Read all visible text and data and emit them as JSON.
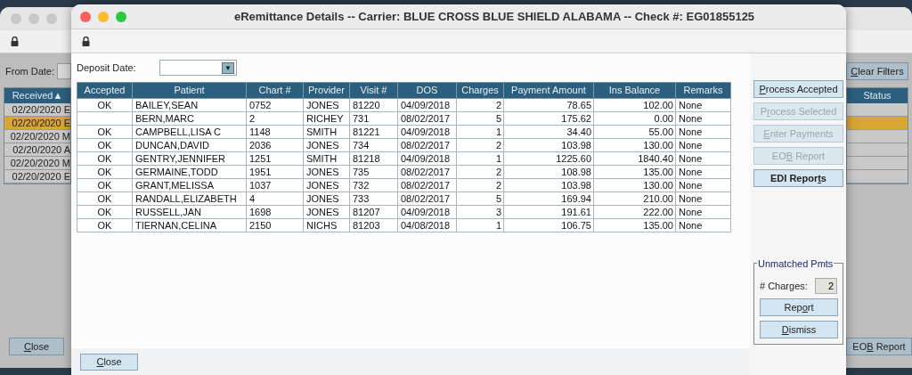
{
  "back_window": {
    "from_date_label": "From Date:",
    "clear_filters": {
      "key": "C",
      "post": "lear Filters"
    },
    "columns": [
      {
        "label": "Received▲"
      },
      {
        "label": "Status"
      }
    ],
    "rows": [
      {
        "received": "02/20/2020 E",
        "selected": false
      },
      {
        "received": "02/20/2020 E",
        "selected": true
      },
      {
        "received": "02/20/2020 M",
        "selected": false
      },
      {
        "received": "02/20/2020 A",
        "selected": false
      },
      {
        "received": "02/20/2020 M",
        "selected": false
      },
      {
        "received": "02/20/2020 E",
        "selected": false
      }
    ],
    "close": {
      "key": "C",
      "post": "lose"
    },
    "eob_report": {
      "pre": "EO",
      "key": "B",
      "post": " Report"
    }
  },
  "window": {
    "title": "eRemittance Details -- Carrier: BLUE CROSS BLUE SHIELD ALABAMA -- Check #: EG01855125"
  },
  "deposit_date": {
    "label": "Deposit Date:",
    "dropdown": "▼"
  },
  "table": {
    "columns": [
      {
        "label": "Accepted"
      },
      {
        "label": "Patient"
      },
      {
        "label": "Chart #"
      },
      {
        "label": "Provider"
      },
      {
        "label": "Visit #"
      },
      {
        "label": "DOS"
      },
      {
        "label": "Charges"
      },
      {
        "label": "Payment Amount"
      },
      {
        "label": "Ins Balance"
      },
      {
        "label": "Remarks"
      }
    ],
    "rows": [
      [
        "OK",
        "BAILEY,SEAN",
        "0752",
        "JONES",
        "81220",
        "04/09/2018",
        "2",
        "78.65",
        "102.00",
        "None"
      ],
      [
        "",
        "BERN,MARC",
        "2",
        "RICHEY",
        "731",
        "08/02/2017",
        "5",
        "175.62",
        "0.00",
        "None"
      ],
      [
        "OK",
        "CAMPBELL,LISA C",
        "1148",
        "SMITH",
        "81221",
        "04/09/2018",
        "1",
        "34.40",
        "55.00",
        "None"
      ],
      [
        "OK",
        "DUNCAN,DAVID",
        "2036",
        "JONES",
        "734",
        "08/02/2017",
        "2",
        "103.98",
        "130.00",
        "None"
      ],
      [
        "OK",
        "GENTRY,JENNIFER",
        "1251",
        "SMITH",
        "81218",
        "04/09/2018",
        "1",
        "1225.60",
        "1840.40",
        "None"
      ],
      [
        "OK",
        "GERMAINE,TODD",
        "1951",
        "JONES",
        "735",
        "08/02/2017",
        "2",
        "108.98",
        "135.00",
        "None"
      ],
      [
        "OK",
        "GRANT,MELISSA",
        "1037",
        "JONES",
        "732",
        "08/02/2017",
        "2",
        "103.98",
        "130.00",
        "None"
      ],
      [
        "OK",
        "RANDALL,ELIZABETH",
        "4",
        "JONES",
        "733",
        "08/02/2017",
        "5",
        "169.94",
        "210.00",
        "None"
      ],
      [
        "OK",
        "RUSSELL,JAN",
        "1698",
        "JONES",
        "81207",
        "04/09/2018",
        "3",
        "191.61",
        "222.00",
        "None"
      ],
      [
        "OK",
        "TIERNAN,CELINA",
        "2150",
        "NICHS",
        "81203",
        "04/08/2018",
        "1",
        "106.75",
        "135.00",
        "None"
      ]
    ]
  },
  "actions": [
    {
      "key": "P",
      "post": "rocess Accepted",
      "disabled": false,
      "bold": false
    },
    {
      "pre": "P",
      "key": "r",
      "post": "ocess Selected",
      "disabled": true,
      "bold": false
    },
    {
      "key": "E",
      "post": "nter Payments",
      "disabled": true,
      "bold": false
    },
    {
      "pre": "EO",
      "key": "B",
      "post": " Report",
      "disabled": true,
      "bold": false
    },
    {
      "pre": "EDI Repor",
      "key": "t",
      "post": "s",
      "disabled": false,
      "bold": true
    }
  ],
  "unmatched": {
    "title": "Unmatched Pmts",
    "charges_label": "# Charges:",
    "charges_value": "2",
    "buttons": [
      {
        "pre": "Rep",
        "key": "o",
        "post": "rt"
      },
      {
        "key": "D",
        "post": "ismiss"
      }
    ]
  },
  "close": {
    "key": "C",
    "post": "lose"
  }
}
